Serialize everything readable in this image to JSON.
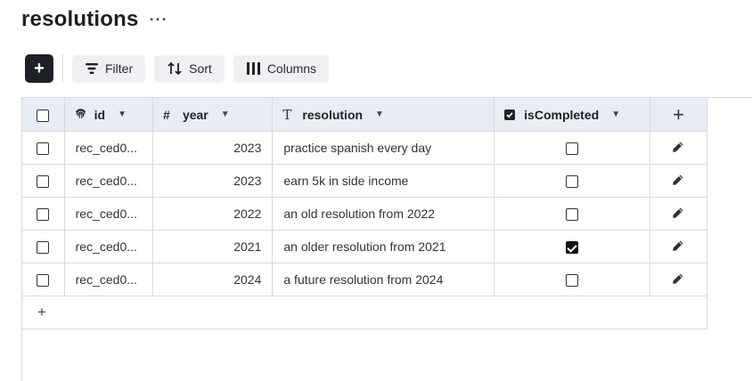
{
  "page": {
    "title": "resolutions",
    "more_label": "···"
  },
  "toolbar": {
    "add_label": "+",
    "filter_label": "Filter",
    "sort_label": "Sort",
    "columns_label": "Columns"
  },
  "table": {
    "columns": [
      {
        "label": "id",
        "icon": "fingerprint-icon"
      },
      {
        "label": "year",
        "icon": "hash-icon",
        "icon_text": "#"
      },
      {
        "label": "resolution",
        "icon": "text-type-icon",
        "icon_text": "T"
      },
      {
        "label": "isCompleted",
        "icon": "checkbox-icon"
      }
    ],
    "add_column_label": "+",
    "add_row_label": "+",
    "rows": [
      {
        "id": "rec_ced0...",
        "year": "2023",
        "resolution": "practice spanish every day",
        "isCompleted": false
      },
      {
        "id": "rec_ced0...",
        "year": "2023",
        "resolution": "earn 5k in side income",
        "isCompleted": false
      },
      {
        "id": "rec_ced0...",
        "year": "2022",
        "resolution": "an old resolution from 2022",
        "isCompleted": false
      },
      {
        "id": "rec_ced0...",
        "year": "2021",
        "resolution": "an older resolution from 2021",
        "isCompleted": true
      },
      {
        "id": "rec_ced0...",
        "year": "2024",
        "resolution": "a future resolution from 2024",
        "isCompleted": false
      }
    ]
  },
  "colors": {
    "header_bg": "#e8edf5",
    "button_bg": "#eef0f4",
    "add_button_bg": "#1e2228",
    "border": "#d5d9e0"
  }
}
